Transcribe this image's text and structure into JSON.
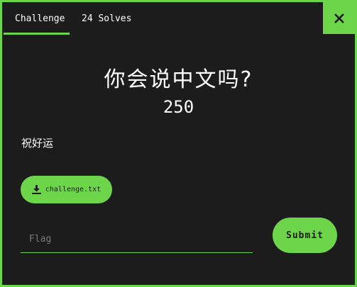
{
  "colors": {
    "accent": "#6dd54a",
    "background": "#1c1c1c",
    "text": "#ffffff",
    "placeholder": "#7a7a7a"
  },
  "tabs": [
    {
      "label": "Challenge",
      "active": true
    },
    {
      "label": "24 Solves",
      "active": false
    }
  ],
  "close_icon": "close-icon",
  "challenge": {
    "title": "你会说中文吗?",
    "points": "250",
    "description": "祝好运"
  },
  "file": {
    "icon": "download-icon",
    "label": "challenge.txt"
  },
  "flag": {
    "placeholder": "Flag",
    "value": ""
  },
  "submit": {
    "label": "Submit"
  }
}
